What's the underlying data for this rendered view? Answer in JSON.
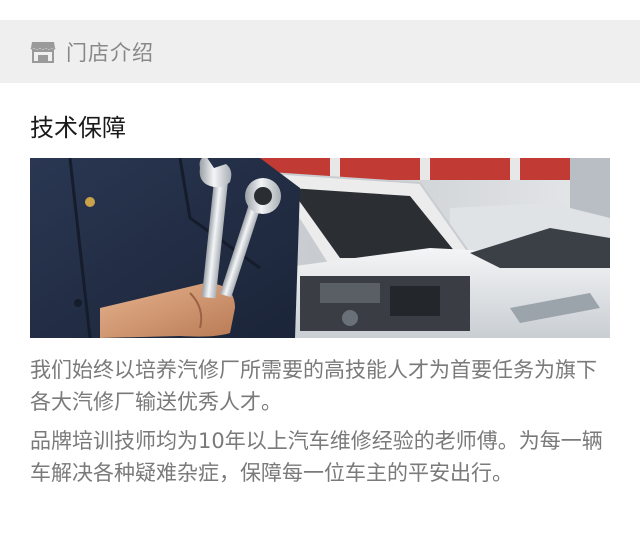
{
  "header": {
    "icon": "store-icon",
    "title": "门店介绍"
  },
  "section": {
    "subtitle": "技术保障",
    "image_icon": "mechanic-wrench-photo",
    "paragraphs": [
      "我们始终以培养汽修厂所需要的高技能人才为首要任务为旗下各大汽修厂输送优秀人才。",
      "品牌培训技师均为10年以上汽车维修经验的老师傅。为每一辆车解决各种疑难杂症，保障每一位车主的平安出行。"
    ]
  },
  "colors": {
    "header_bg": "#efefef",
    "header_text": "#888888",
    "title_text": "#1a1a1a",
    "body_text": "#7a7a7a"
  }
}
